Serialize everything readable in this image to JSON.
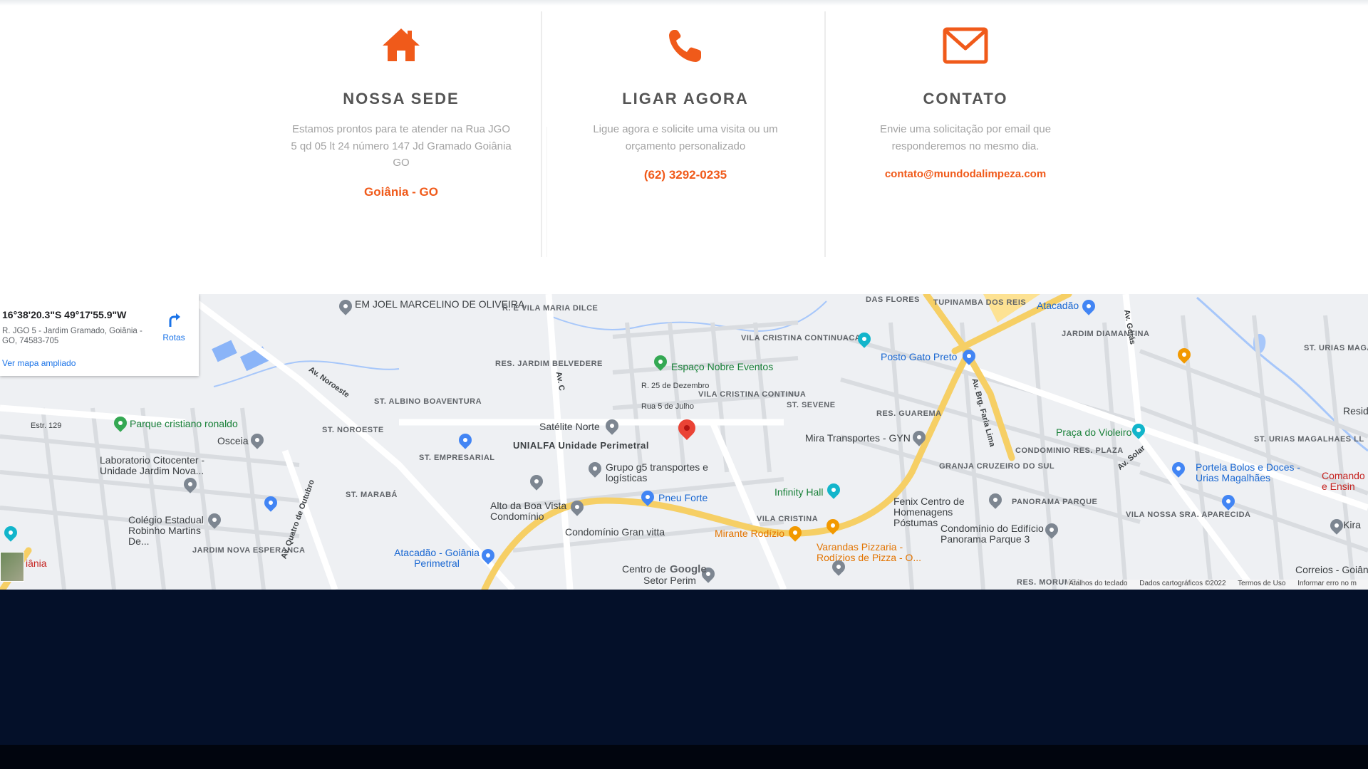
{
  "cards": [
    {
      "title": "NOSSA SEDE",
      "text": "Estamos prontos para te atender na Rua JGO 5 qd 05 lt 24 número 147 Jd Gramado Goiânia GO",
      "accent": "Goiânia - GO",
      "icon": "home-icon"
    },
    {
      "title": "LIGAR AGORA",
      "text": "Ligue agora e solicite uma visita ou um orçamento personalizado",
      "accent": "(62) 3292-0235",
      "icon": "phone-icon"
    },
    {
      "title": "CONTATO",
      "text": "Envie uma solicitação por email que responderemos no mesmo dia.",
      "accent": "contato@mundodalimpeza.com",
      "icon": "envelope-icon"
    }
  ],
  "colors": {
    "accent": "#f05a1a",
    "heading": "#555555",
    "footer": "#041029"
  },
  "map": {
    "info": {
      "coords": "16°38'20.3\"S 49°17'55.9\"W",
      "address": "R. JGO 5 - Jardim Gramado, Goiânia - GO, 74583-705",
      "routes": "Rotas",
      "larger_map": "Ver mapa ampliado"
    },
    "google": "Google",
    "attribution": {
      "shortcuts": "Atalhos do teclado",
      "data": "Dados cartográficos ©2022",
      "terms": "Termos de Uso",
      "report": "Informar erro no m"
    },
    "labels": {
      "joel": "EM JOEL MARCELINO DE OLIVEIRA",
      "vila_maria": "R. E VILA MARIA DILCE",
      "flores": "DAS FLORES",
      "tupinamba": "TUPINAMBA DOS REIS",
      "atacadao_top": "Atacadão",
      "jardim_diamantina": "JARDIM DIAMANTINA",
      "st_urias": "ST. URIAS MAGALHÃES",
      "vila_cristina_cont": "VILA CRISTINA CONTINUACAO",
      "posto_gato": "Posto Gato Preto",
      "res_jardim_belvedere": "RES. JARDIM BELVEDERE",
      "espaco_nobre": "Espaço Nobre Eventos",
      "r25": "R. 25 de Dezembro",
      "r5julho": "Rua 5 de Julho",
      "vila_cristina_continua": "VILA CRISTINA CONTINUA",
      "st_sevene": "ST. SEVENE",
      "res_guarema": "RES. GUAREMA",
      "st_albino": "ST. ALBINO BOAVENTURA",
      "estr129": "Estr. 129",
      "parque_cristiano": "Parque cristiano ronaldo",
      "st_noroeste": "ST. NOROESTE",
      "satelite_norte": "Satélite Norte",
      "mira_transportes": "Mira Transportes - GYN",
      "praca_violeiro": "Praça do Violeiro",
      "st_urias_ll": "ST. URIAS MAGALHAES LL",
      "resid": "Resid",
      "osceia": "Osceia",
      "st_empresarial": "ST. EMPRESARIAL",
      "unialfa": "UNIALFA Unidade Perimetral",
      "lab_citocenter": "Laboratorio Citocenter - Unidade Jardim Nova...",
      "grupo_g5": "Grupo g5 transportes e logísticas",
      "granja": "GRANJA CRUZEIRO DO SUL",
      "condominio_res_plaza": "CONDOMINIO RES. PLAZA",
      "portela": "Portela Bolos e Doces - Urias Magalhães",
      "comando": "Comando e Ensin",
      "st_maraba": "ST. MARABÁ",
      "infinity": "Infinity Hall",
      "pneu_forte": "Pneu Forte",
      "alto_boa_vista": "Alto da Boa Vista Condomínio",
      "colegio": "Colégio Estadual Robinho Martins De...",
      "fenix": "Fenix Centro de Homenagens Póstumas",
      "panorama_parque": "PANORAMA PARQUE",
      "vila_nossa": "VILA NOSSA SRA. APARECIDA",
      "kira": "Kira",
      "condominio_gran": "Condomínio Gran vitta",
      "mirante": "Mirante Rodízio",
      "varandas": "Varandas Pizzaria - Rodízios de Pizza - O...",
      "condominio_edificio": "Condomínio do Edifício Panorama Parque 3",
      "vila_cristina": "VILA CRISTINA",
      "jardim_nova": "JARDIM NOVA ESPERANCA",
      "atacadao_perimetral": "Atacadão - Goiânia Perimetral",
      "centro_de": "Centro de",
      "setor_perim": "Setor Perim",
      "correios": "Correios - Goiân",
      "res_morumbi": "RES. MORUMBI",
      "goiania": "iânia",
      "av_noroeste": "Av. Noroeste",
      "av_quatro": "Av. Quatro de Outubro",
      "av_brg": "Av. Brg. Faria Lima",
      "av_goias": "Av. Goiás",
      "av_solar": "Av. Solar",
      "av_c": "Av. C"
    }
  }
}
